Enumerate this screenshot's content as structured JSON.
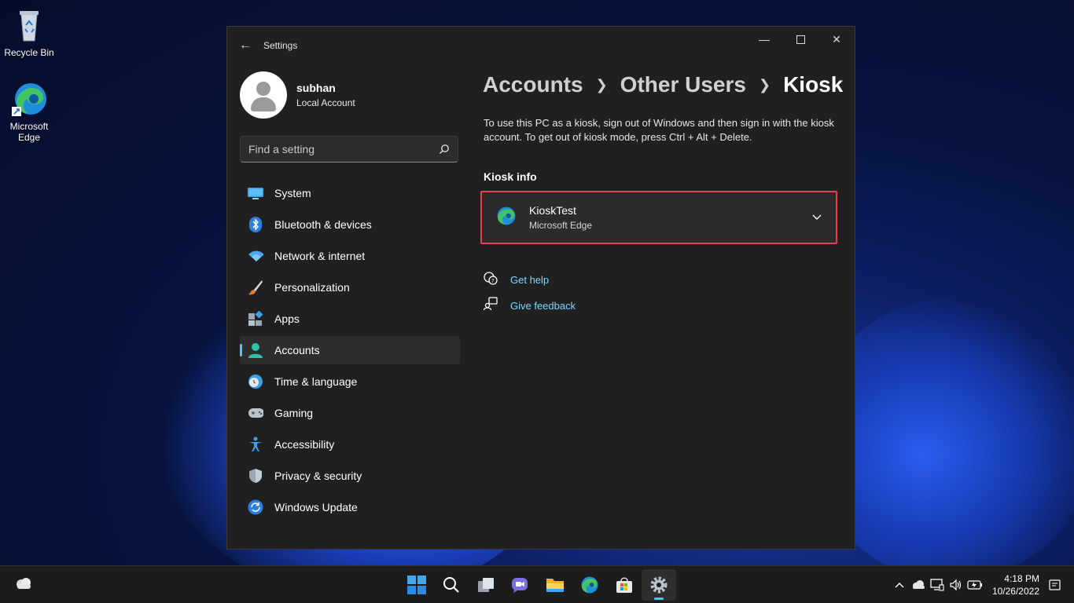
{
  "desktop": {
    "icons": [
      {
        "label": "Recycle Bin"
      },
      {
        "label": "Microsoft Edge"
      }
    ]
  },
  "window": {
    "title": "Settings"
  },
  "profile": {
    "name": "subhan",
    "type": "Local Account"
  },
  "search": {
    "placeholder": "Find a setting"
  },
  "nav": {
    "items": [
      {
        "label": "System",
        "icon": "monitor-icon"
      },
      {
        "label": "Bluetooth & devices",
        "icon": "bluetooth-icon"
      },
      {
        "label": "Network & internet",
        "icon": "wifi-icon"
      },
      {
        "label": "Personalization",
        "icon": "brush-icon"
      },
      {
        "label": "Apps",
        "icon": "apps-icon"
      },
      {
        "label": "Accounts",
        "icon": "person-icon"
      },
      {
        "label": "Time & language",
        "icon": "globe-clock-icon"
      },
      {
        "label": "Gaming",
        "icon": "gamepad-icon"
      },
      {
        "label": "Accessibility",
        "icon": "accessibility-icon"
      },
      {
        "label": "Privacy & security",
        "icon": "shield-icon"
      },
      {
        "label": "Windows Update",
        "icon": "update-icon"
      }
    ],
    "active": "Accounts"
  },
  "breadcrumb": {
    "items": [
      "Accounts",
      "Other Users",
      "Kiosk"
    ]
  },
  "main": {
    "description": "To use this PC as a kiosk, sign out of Windows and then sign in with the kiosk account. To get out of kiosk mode, press Ctrl + Alt + Delete.",
    "section_title": "Kiosk info",
    "kiosk": {
      "name": "KioskTest",
      "app": "Microsoft Edge"
    },
    "links": {
      "get_help": "Get help",
      "give_feedback": "Give feedback"
    }
  },
  "taskbar": {
    "apps": [
      "start-icon",
      "search-icon",
      "task-view-icon",
      "chat-icon",
      "file-explorer-icon",
      "edge-icon",
      "store-icon",
      "settings-icon"
    ],
    "active_app": "settings-icon",
    "time": "4:18 PM",
    "date": "10/26/2022"
  },
  "colors": {
    "accent": "#4cc2ff",
    "highlight_border": "#e0424e",
    "link": "#7fd6ff"
  }
}
